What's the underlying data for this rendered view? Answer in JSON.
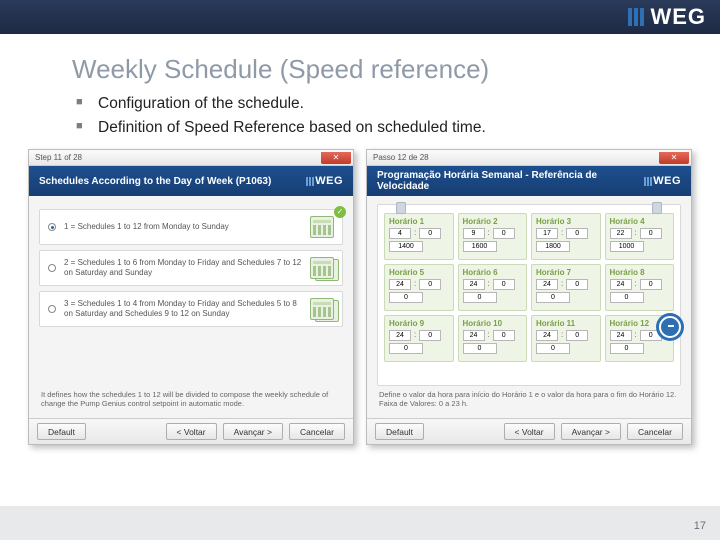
{
  "brand": "WEG",
  "page": {
    "title": "Weekly Schedule (Speed reference)",
    "bullets": [
      "Configuration of the schedule.",
      "Definition of Speed Reference based on scheduled time."
    ],
    "page_number": "17"
  },
  "left_window": {
    "step": "Step 11 of 28",
    "ribbon_title": "Schedules According to the Day of Week (P1063)",
    "options": [
      {
        "selected": true,
        "text": "1 = Schedules 1 to 12 from Monday to Sunday"
      },
      {
        "selected": false,
        "text": "2 = Schedules 1 to 6 from Monday to Friday and Schedules 7 to 12 on Saturday and Sunday"
      },
      {
        "selected": false,
        "text": "3 = Schedules 1 to 4 from Monday to Friday and Schedules 5 to 8 on Saturday and Schedules 9 to 12 on Sunday"
      }
    ],
    "hint": "It defines how the schedules 1 to 12 will be divided to compose the weekly schedule of change the Pump Genius control setpoint in automatic mode.",
    "buttons": {
      "default": "Default",
      "back": "< Voltar",
      "next": "Avançar >",
      "cancel": "Cancelar"
    }
  },
  "right_window": {
    "step": "Passo 12 de 28",
    "ribbon_title": "Programação Horária Semanal - Referência de Velocidade",
    "slot_label_prefix": "Horário",
    "slots": [
      {
        "h": "4",
        "m": "0",
        "ref": "1400"
      },
      {
        "h": "9",
        "m": "0",
        "ref": "1600"
      },
      {
        "h": "17",
        "m": "0",
        "ref": "1800"
      },
      {
        "h": "22",
        "m": "0",
        "ref": "1000"
      },
      {
        "h": "24",
        "m": "0",
        "ref": "0"
      },
      {
        "h": "24",
        "m": "0",
        "ref": "0"
      },
      {
        "h": "24",
        "m": "0",
        "ref": "0"
      },
      {
        "h": "24",
        "m": "0",
        "ref": "0"
      },
      {
        "h": "24",
        "m": "0",
        "ref": "0"
      },
      {
        "h": "24",
        "m": "0",
        "ref": "0"
      },
      {
        "h": "24",
        "m": "0",
        "ref": "0"
      },
      {
        "h": "24",
        "m": "0",
        "ref": "0"
      }
    ],
    "hint": "Define o valor da hora para início do Horário 1 e o valor da hora para o fim do Horário 12. Faixa de Valores: 0 a 23 h.",
    "buttons": {
      "default": "Default",
      "back": "< Voltar",
      "next": "Avançar >",
      "cancel": "Cancelar"
    }
  }
}
